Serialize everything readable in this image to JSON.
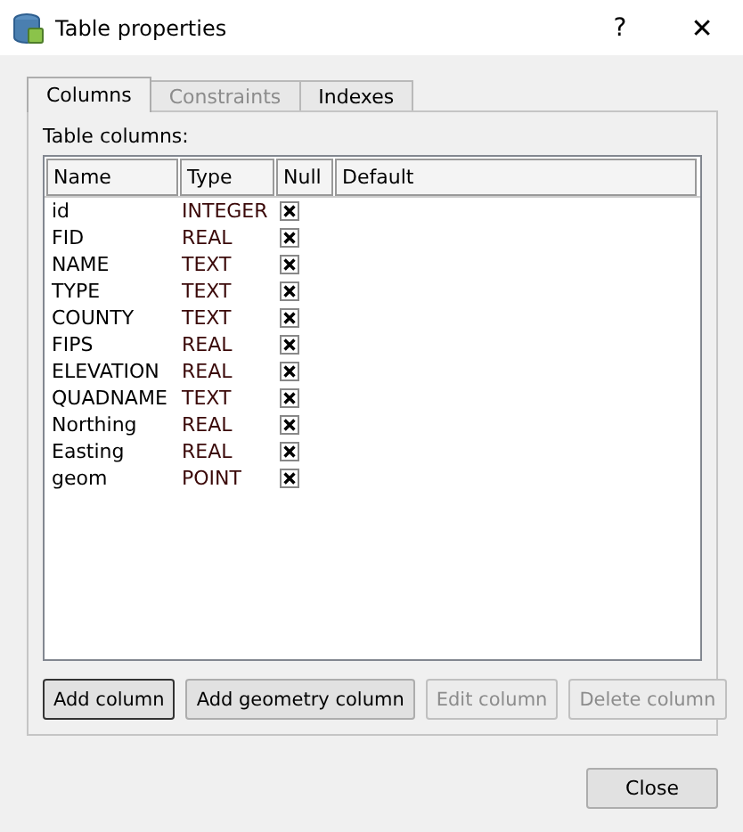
{
  "window": {
    "title": "Table properties",
    "help": "?",
    "close": "✕"
  },
  "tabs": [
    {
      "label": "Columns",
      "selected": true,
      "disabled": false
    },
    {
      "label": "Constraints",
      "selected": false,
      "disabled": true
    },
    {
      "label": "Indexes",
      "selected": false,
      "disabled": false
    }
  ],
  "table_label": "Table columns:",
  "table": {
    "columns": [
      "Name",
      "Type",
      "Null",
      "Default"
    ],
    "rows": [
      {
        "name": "id",
        "type": "INTEGER",
        "null": true
      },
      {
        "name": "FID",
        "type": "REAL",
        "null": true
      },
      {
        "name": "NAME",
        "type": "TEXT",
        "null": true
      },
      {
        "name": "TYPE",
        "type": "TEXT",
        "null": true
      },
      {
        "name": "COUNTY",
        "type": "TEXT",
        "null": true
      },
      {
        "name": "FIPS",
        "type": "REAL",
        "null": true
      },
      {
        "name": "ELEVATION",
        "type": "REAL",
        "null": true
      },
      {
        "name": "QUADNAME",
        "type": "TEXT",
        "null": true
      },
      {
        "name": "Northing",
        "type": "REAL",
        "null": true
      },
      {
        "name": "Easting",
        "type": "REAL",
        "null": true
      },
      {
        "name": "geom",
        "type": "POINT",
        "null": true
      }
    ]
  },
  "buttons": [
    {
      "label": "Add column",
      "disabled": false
    },
    {
      "label": "Add geometry column",
      "disabled": false
    },
    {
      "label": "Edit column",
      "disabled": true
    },
    {
      "label": "Delete column",
      "disabled": true
    }
  ],
  "close_button": "Close"
}
